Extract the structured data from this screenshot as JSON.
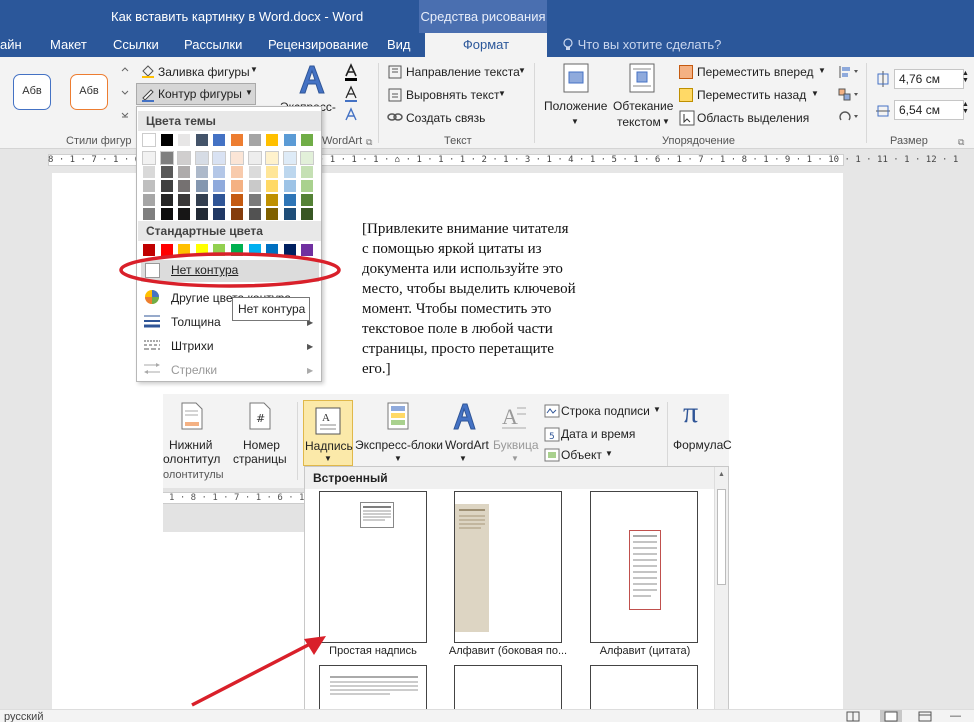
{
  "titlebar": {
    "doc_title": "Как вставить картинку в Word.docx - Word",
    "context_tab": "Средства рисования"
  },
  "tabs": {
    "items": [
      "айн",
      "Макет",
      "Ссылки",
      "Рассылки",
      "Рецензирование",
      "Вид"
    ],
    "active": "Формат",
    "tell_me": "Что вы хотите сделать?"
  },
  "ribbon": {
    "styles": {
      "sample_label": "Абв",
      "group": "Стили фигур"
    },
    "shape_fill": "Заливка фигуры",
    "shape_outline": "Контур фигуры",
    "wordart": {
      "express_label": "Экспресс-",
      "group": "WordArt"
    },
    "text": {
      "direction": "Направление текста",
      "align": "Выровнять текст",
      "link": "Создать связь",
      "group": "Текст"
    },
    "arrange": {
      "position": "Положение",
      "wrap_line1": "Обтекание",
      "wrap_line2": "текстом",
      "bring_forward": "Переместить вперед",
      "send_backward": "Переместить назад",
      "selection_pane": "Область выделения",
      "group": "Упорядочение"
    },
    "size": {
      "height": "4,76 см",
      "width": "6,54 см",
      "group": "Размер"
    }
  },
  "ruler": {
    "ticks": "8 · 1 · 7 · 1 · 6 · 1 · 5 · 1 · 4 · 1 · 3 · 1 · 2 · 1 · 1 · 1 · ⌂ · 1 · 1 · 1 · 2 · 1 · 3 · 1 · 4 · 1 · 5 · 1 · 6 · 1 · 7 · 1 · 8 · 1 · 9 · 1 · 10 · 1 · 11 · 1 · 12 · 1"
  },
  "document": {
    "quote_lines": [
      "[Привлеките внимание читателя",
      "с помощью яркой цитаты из",
      "документа или используйте это",
      "место, чтобы выделить ключевой",
      "момент. Чтобы поместить это",
      "текстовое поле в любой части",
      "страницы, просто перетащите",
      "его.]"
    ]
  },
  "dropdown": {
    "theme_colors_header": "Цвета темы",
    "standard_colors_header": "Стандартные цвета",
    "no_outline": "Нет контура",
    "more_colors": "Другие цвета контура...",
    "weight": "Толщина",
    "dashes": "Штрихи",
    "arrows": "Стрелки",
    "tooltip": "Нет контура",
    "theme_palette": [
      [
        "#ffffff",
        "#000000",
        "#e7e6e6",
        "#44546a",
        "#4472c4",
        "#ed7d31",
        "#a5a5a5",
        "#ffc000",
        "#5b9bd5",
        "#70ad47"
      ],
      [
        "#f2f2f2",
        "#7f7f7f",
        "#d0cece",
        "#d6dce5",
        "#d9e2f3",
        "#fbe5d6",
        "#ededed",
        "#fff2cc",
        "#deebf7",
        "#e2f0d9"
      ],
      [
        "#d9d9d9",
        "#595959",
        "#aeabab",
        "#adb9ca",
        "#b4c7e7",
        "#f8cbad",
        "#dbdbdb",
        "#ffe699",
        "#bdd7ee",
        "#c5e0b4"
      ],
      [
        "#bfbfbf",
        "#404040",
        "#757171",
        "#8497b0",
        "#8faadc",
        "#f4b183",
        "#c9c9c9",
        "#ffd966",
        "#9dc3e6",
        "#a9d18e"
      ],
      [
        "#a6a6a6",
        "#262626",
        "#3a3838",
        "#333f50",
        "#2f5597",
        "#c55a11",
        "#7b7b7b",
        "#bf9000",
        "#2e75b6",
        "#548235"
      ],
      [
        "#7f7f7f",
        "#0d0d0d",
        "#171616",
        "#222a35",
        "#203864",
        "#843c0c",
        "#525252",
        "#7f6000",
        "#1f4e79",
        "#385723"
      ]
    ],
    "standard_palette": [
      "#c00000",
      "#ff0000",
      "#ffc000",
      "#ffff00",
      "#92d050",
      "#00b050",
      "#00b0f0",
      "#0070c0",
      "#002060",
      "#7030a0"
    ]
  },
  "inner_ribbon": {
    "footer_line1": "Нижний",
    "footer_line2": "олонтитул",
    "page_number_line1": "Номер",
    "page_number_line2": "страницы",
    "group_label": "олонтитулы",
    "textbox": "Надпись",
    "quick_parts": "Экспресс-блоки",
    "wordart": "WordArt",
    "dropcap": "Буквица",
    "signature_line": "Строка подписи",
    "date_time": "Дата и время",
    "object": "Объект",
    "formula": "Формула",
    "formula_cut": "С",
    "ruler_ticks": "1 · 8 · 1 · 7 · 1 · 6 · 1"
  },
  "gallery": {
    "header": "Встроенный",
    "items": [
      "Простая надпись",
      "Алфавит (боковая по...",
      "Алфавит (цитата)"
    ]
  },
  "statusbar": {
    "language": "русский"
  },
  "colors": {
    "word_blue": "#2b579a",
    "annotation_red": "#d9202a",
    "highlight_yellow": "#fbe9a9"
  }
}
